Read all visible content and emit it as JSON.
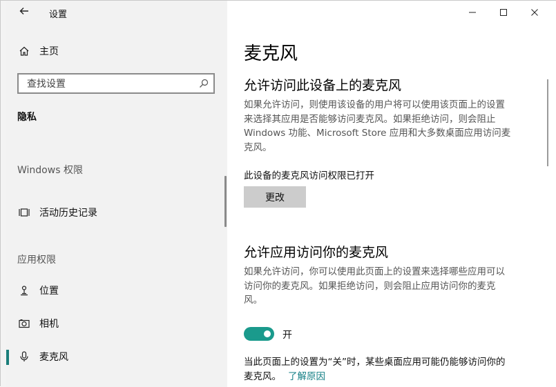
{
  "window": {
    "title": "设置",
    "controls": {
      "minimize": "—",
      "maximize": "☐",
      "close": "✕"
    }
  },
  "sidebar": {
    "home_label": "主页",
    "search_placeholder": "查找设置",
    "section_title": "隐私",
    "group_windows": "Windows 权限",
    "history_label": "活动历史记录",
    "group_apps": "应用权限",
    "items": [
      {
        "label": "位置",
        "icon": "location-icon"
      },
      {
        "label": "相机",
        "icon": "camera-icon"
      },
      {
        "label": "麦克风",
        "icon": "microphone-icon",
        "active": true
      }
    ]
  },
  "content": {
    "page_title": "麦克风",
    "section1": {
      "heading": "允许访问此设备上的麦克风",
      "description_line1": "如果允许访问，则使用该设备的用户将可以使用该页面上的设置",
      "description_line2": "来选择其应用是否能够访问麦克风。如果拒绝访问，则会阻止",
      "description_line3": "Windows 功能、Microsoft Store 应用和大多数桌面应用访问麦",
      "description_line4": "克风。",
      "status": "此设备的麦克风访问权限已打开",
      "change_button": "更改"
    },
    "section2": {
      "heading": "允许应用访问你的麦克风",
      "description_line1": "如果允许访问，你可以使用此页面上的设置来选择哪些应用可以",
      "description_line2": "访问你的麦克风。如果拒绝访问，则会阻止应用访问你的麦克",
      "description_line3": "风。",
      "toggle_state": "开",
      "toggle_on": true
    },
    "note_line1": "当此页面上的设置为“关”时，某些桌面应用可能仍能够访问你的",
    "note_line2": "麦克风。",
    "learn_more": "了解原因"
  },
  "colors": {
    "accent": "#1a9a8c",
    "link": "#127e84",
    "sidebar_bg": "#f2f2f2",
    "button_bg": "#cccccc"
  }
}
